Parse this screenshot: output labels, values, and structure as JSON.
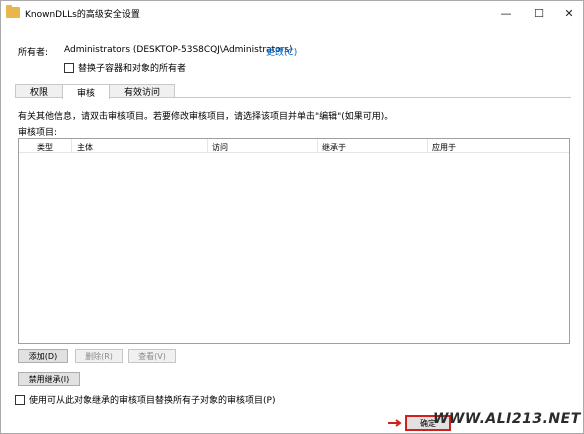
{
  "window": {
    "title": "KnownDLLs的高级安全设置",
    "min_glyph": "—",
    "max_glyph": "☐",
    "close_glyph": "✕"
  },
  "owner": {
    "label": "所有者:",
    "value": "Administrators (DESKTOP-53S8CQJ\\Administrators)",
    "change_link": "更改(C)",
    "replace_checkbox_label": "替换子容器和对象的所有者"
  },
  "tabs": [
    {
      "label": "权限"
    },
    {
      "label": "审核"
    },
    {
      "label": "有效访问"
    }
  ],
  "active_tab": "审核",
  "info_text": "有关其他信息，请双击审核项目。若要修改审核项目，请选择该项目并单击\"编辑\"(如果可用)。",
  "entries_label": "审核项目:",
  "table": {
    "columns": [
      "类型",
      "主体",
      "访问",
      "继承于",
      "应用于"
    ],
    "rows": []
  },
  "buttons": {
    "add": "添加(D)",
    "remove": "删除(R)",
    "view": "查看(V)",
    "disable_inheritance": "禁用继承(I)"
  },
  "replace_children_label": "使用可从此对象继承的审核项目替换所有子对象的审核项目(P)",
  "ok_button": "确定",
  "watermark": "WWW.ALI213.NET",
  "colors": {
    "link": "#0066cc",
    "highlight": "#d2201c"
  },
  "icons": {
    "title_icon": "folder-icon",
    "arrow": "arrow-right-icon"
  }
}
